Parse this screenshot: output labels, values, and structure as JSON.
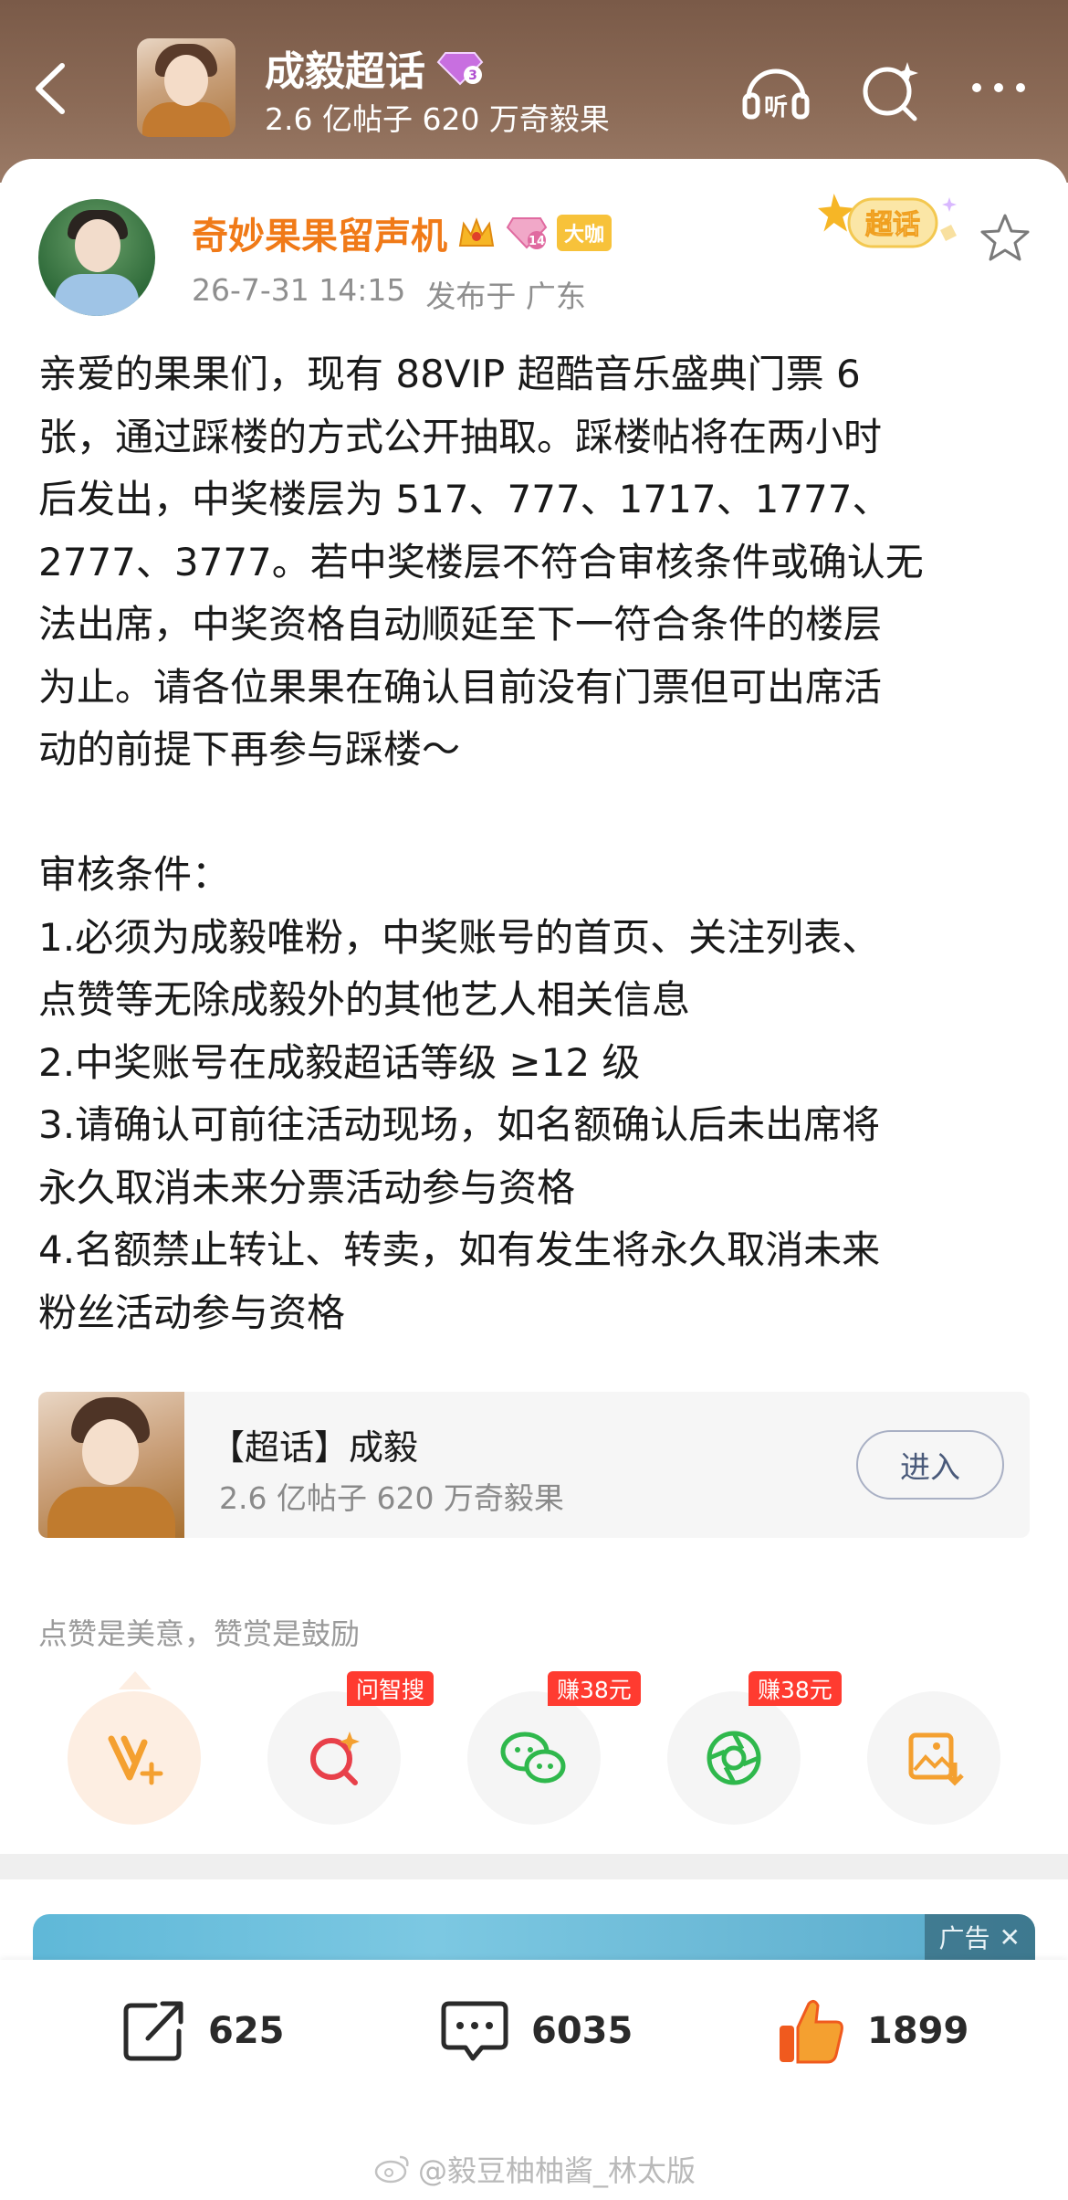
{
  "header": {
    "title": "成毅超话",
    "level_badge": "3",
    "subtitle": "2.6 亿帖子 620 万奇毅果",
    "listen_label": "听"
  },
  "post": {
    "author": "奇妙果果留声机",
    "level_badge": "14",
    "vip_badge": "大咖",
    "date": "26-7-31 14:15",
    "location": "发布于 广东",
    "sticker_label": "超话",
    "body": "亲爱的果果们，现有 88VIP 超酷音乐盛典门票 6\n张，通过踩楼的方式公开抽取。踩楼帖将在两小时\n后发出，中奖楼层为 517、777、1717、1777、\n2777、3777。若中奖楼层不符合审核条件或确认无\n法出席，中奖资格自动顺延至下一符合条件的楼层\n为止。请各位果果在确认目前没有门票但可出席活\n动的前提下再参与踩楼～\n\n审核条件：\n1.必须为成毅唯粉，中奖账号的首页、关注列表、\n点赞等无除成毅外的其他艺人相关信息\n2.中奖账号在成毅超话等级 ≥12 级\n3.请确认可前往活动现场，如名额确认后未出席将\n永久取消未来分票活动参与资格\n4.名额禁止转让、转卖，如有发生将永久取消未来\n粉丝活动参与资格"
  },
  "topic_card": {
    "title": "【超话】成毅",
    "subtitle": "2.6 亿帖子 620 万奇毅果",
    "enter_label": "进入"
  },
  "encourage_text": "点赞是美意，赞赏是鼓励",
  "actions": {
    "search_tag": "问智搜",
    "wechat_tag": "赚38元",
    "moments_tag": "赚38元"
  },
  "ad": {
    "label": "广告",
    "close": "✕"
  },
  "bottom_bar": {
    "repost_count": "625",
    "comment_count": "6035",
    "like_count": "1899"
  },
  "watermark": "@毅豆柚柚酱_林太版",
  "colors": {
    "accent_orange": "#f07a18",
    "header_brown": "#8b6a56",
    "tag_red": "#ff3b30"
  }
}
